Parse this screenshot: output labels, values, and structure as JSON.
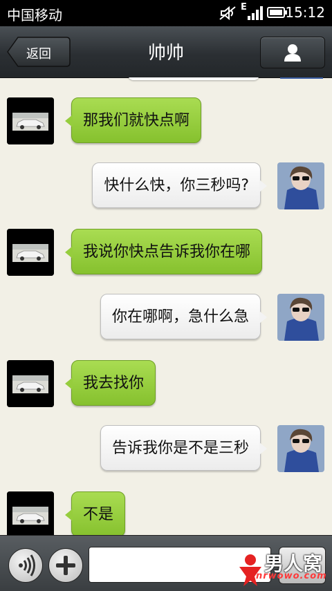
{
  "status_bar": {
    "carrier": "中国移动",
    "time": "15:12",
    "network": "E",
    "icons": [
      "mute-icon",
      "network-e-icon",
      "signal-icon",
      "battery-icon"
    ]
  },
  "header": {
    "back_label": "返回",
    "title": "帅帅",
    "profile_icon": "person-icon"
  },
  "messages": [
    {
      "side": "left",
      "text": "那我们就快点啊"
    },
    {
      "side": "right",
      "text": "快什么快，你三秒吗?"
    },
    {
      "side": "left",
      "text": "我说你快点告诉我你在哪"
    },
    {
      "side": "right",
      "text": "你在哪啊，急什么急"
    },
    {
      "side": "left",
      "text": "我去找你"
    },
    {
      "side": "right",
      "text": "告诉我你是不是三秒"
    },
    {
      "side": "left",
      "text": "不是"
    }
  ],
  "input_bar": {
    "voice_icon": "voice-icon",
    "add_icon": "plus-icon",
    "input_value": "",
    "send_label": ""
  },
  "watermark": {
    "brand": "男人窝",
    "site": "nrwowo.com"
  },
  "colors": {
    "sent_bubble": "#9dd443",
    "received_bubble": "#ffffff",
    "header": "#2f3437",
    "background": "#f2f0e6"
  }
}
